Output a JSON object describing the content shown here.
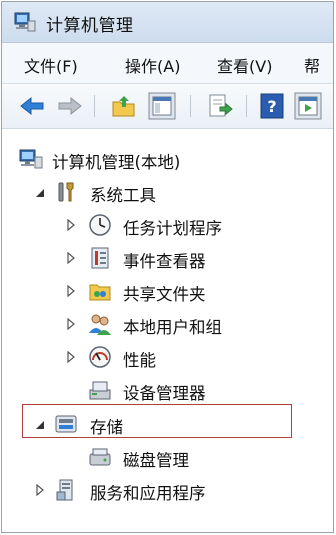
{
  "window": {
    "title": "计算机管理"
  },
  "menu": {
    "items": [
      "文件(F)",
      "操作(A)",
      "查看(V)",
      "帮"
    ]
  },
  "toolbar": {
    "buttons": [
      "back-icon",
      "forward-icon",
      "up-folder-icon",
      "show-hide-tree-icon",
      "export-list-icon",
      "help-icon",
      "properties-icon"
    ]
  },
  "tree": {
    "root": "计算机管理(本地)",
    "system_tools": "系统工具",
    "task_scheduler": "任务计划程序",
    "event_viewer": "事件查看器",
    "shared_folders": "共享文件夹",
    "local_users": "本地用户和组",
    "performance": "性能",
    "device_manager": "设备管理器",
    "storage": "存储",
    "disk_management": "磁盘管理",
    "services_apps": "服务和应用程序"
  },
  "colors": {
    "selection_border": "#b04040",
    "arrow_blue": "#2f7fd6",
    "help_blue": "#2a5db0"
  }
}
